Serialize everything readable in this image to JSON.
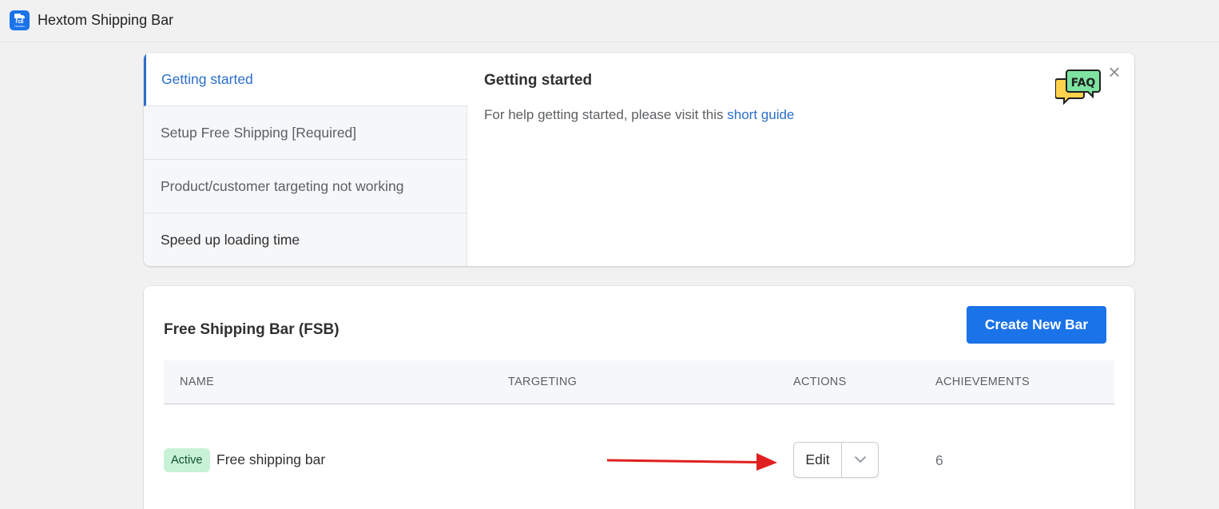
{
  "app": {
    "title": "Hextom Shipping Bar",
    "logo_text": "FSB",
    "logo_brand": "Hextom"
  },
  "faq": {
    "tabs": [
      {
        "label": "Getting started",
        "active": true
      },
      {
        "label": "Setup Free Shipping [Required]",
        "active": false
      },
      {
        "label": "Product/customer targeting not working",
        "active": false
      },
      {
        "label": "Speed up loading time",
        "active": false
      }
    ],
    "heading": "Getting started",
    "text_prefix": "For help getting started, please visit this ",
    "link_text": "short guide",
    "badge_text": "FAQ",
    "close_symbol": "×"
  },
  "fsb": {
    "title": "Free Shipping Bar (FSB)",
    "create_button": "Create New Bar",
    "columns": [
      "NAME",
      "TARGETING",
      "ACTIONS",
      "ACHIEVEMENTS"
    ],
    "rows": [
      {
        "status": "Active",
        "name": "Free shipping bar",
        "targeting": "",
        "edit_label": "Edit",
        "achievements": "6"
      }
    ]
  },
  "colors": {
    "accent": "#1a73e8",
    "link": "#2c6ecb",
    "active_badge_bg": "#c8f2d6",
    "annotation_arrow": "#e02020"
  },
  "icons": [
    "app-logo-icon",
    "faq-icon",
    "close-icon",
    "chevron-down-icon",
    "red-arrow-annotation"
  ]
}
